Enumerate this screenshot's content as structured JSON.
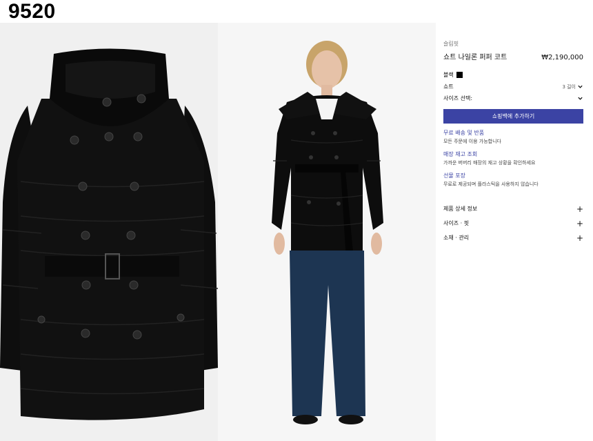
{
  "watermark": "9520",
  "product": {
    "category": "슬림핏",
    "title": "쇼트 나일론 퍼퍼 코트",
    "price": "₩2,190,000",
    "color_label": "블랙",
    "color_hex": "#000000",
    "length_label": "쇼트",
    "length_value": "3 길이",
    "size_label": "사이즈 선택:",
    "add_button": "쇼핑백에 추가하기"
  },
  "info": [
    {
      "title": "무료 배송 및 반품",
      "desc": "모든 주문에 이용 가능합니다"
    },
    {
      "title": "매장 재고 조회",
      "desc": "가까운 버버리 매장의 재고 상황을 확인하세요"
    },
    {
      "title": "선물 포장",
      "desc": "무료로 제공되며 플라스틱을 사용하지 않습니다"
    }
  ],
  "accordion": [
    {
      "label": "제품 상세 정보",
      "icon": "plus-icon"
    },
    {
      "label": "사이즈 · 핏",
      "icon": "plus-icon"
    },
    {
      "label": "소재 · 관리",
      "icon": "plus-icon"
    }
  ],
  "colors": {
    "accent": "#3b43a4",
    "coat": "#0d0d0d",
    "jeans": "#1d3552"
  }
}
